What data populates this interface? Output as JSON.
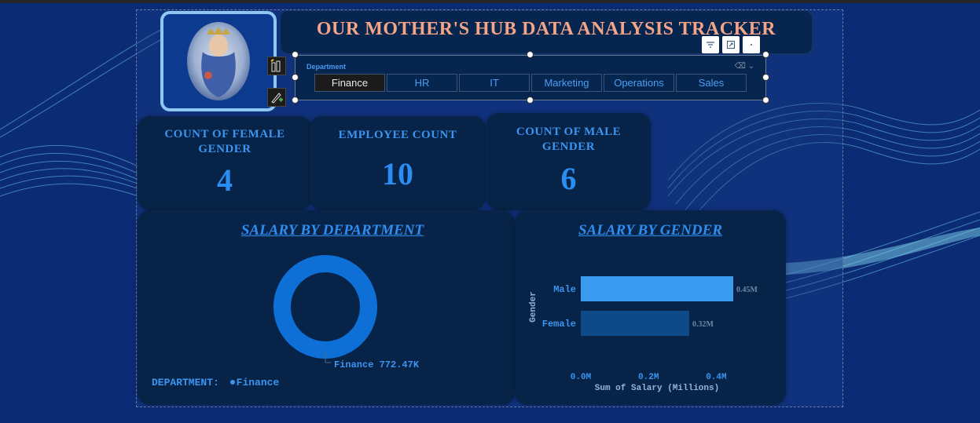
{
  "app": {
    "title": "OUR MOTHER'S HUB DATA ANALYSIS TRACKER"
  },
  "visual_header_icons": [
    "filter-icon",
    "focus-mode-icon",
    "more-options-icon"
  ],
  "slicer": {
    "label": "Department",
    "options": [
      "Finance",
      "HR",
      "IT",
      "Marketing",
      "Operations",
      "Sales"
    ],
    "selected": "Finance"
  },
  "kpis": [
    {
      "label": "COUNT OF FEMALE GENDER",
      "value": "4"
    },
    {
      "label": "EMPLOYEE COUNT",
      "value": "10"
    },
    {
      "label": "COUNT OF MALE GENDER",
      "value": "6"
    }
  ],
  "donut": {
    "title": "SALARY BY DEPARTMENT",
    "legend_label": "DEPARTMENT:",
    "legend_item": "Finance",
    "slice_label": "Finance 772.47K"
  },
  "chart_data": {
    "type": "bar",
    "orientation": "horizontal",
    "title": "SALARY BY GENDER",
    "categories": [
      "Male",
      "Female"
    ],
    "values": [
      0.45,
      0.32
    ],
    "data_labels": [
      "0.45M",
      "0.32M"
    ],
    "xlabel": "Sum of Salary (Millions)",
    "ylabel": "Gender",
    "xticks": [
      "0.0M",
      "0.2M",
      "0.4M"
    ],
    "xlim": [
      0,
      0.45
    ],
    "colors": [
      "#3a9bf0",
      "#0e4a8a"
    ]
  },
  "colors": {
    "background": "#0b2b74",
    "card": "#072448",
    "accent": "#2a8df2",
    "title": "#f4a487"
  }
}
